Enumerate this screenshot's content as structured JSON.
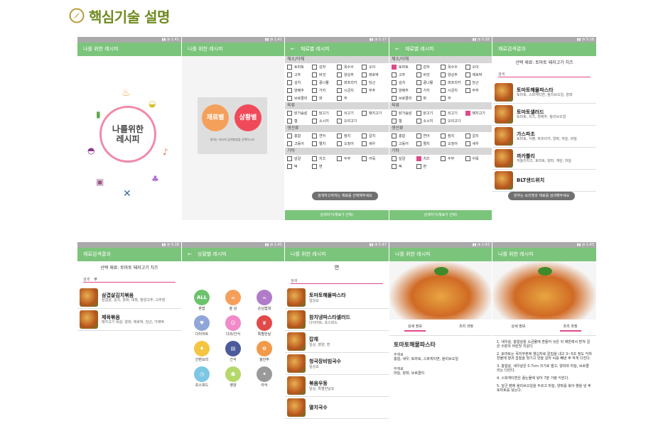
{
  "heading": {
    "title": "핵심기술 설명",
    "accent": "#6f8a1e"
  },
  "theme": {
    "green": "#7bc47b",
    "pink": "#e0488a",
    "status_grey": "#a9a9a9"
  },
  "shots": {
    "s1": {
      "app_title": "나를 위한 레시피",
      "logo_line1": "나를위한",
      "logo_line2": "레시피"
    },
    "s2": {
      "app_title": "나를 위한 레시피",
      "btn_ingredient": "재료별",
      "btn_situation": "상황별",
      "hint": "원하는 레시피 검색방법을 선택하시오"
    },
    "s3": {
      "app_title": "재료별 레시피",
      "toast": "검색하고자하는 재료를 선택해주세요",
      "search_btn": "검색하기(재료가 선택)"
    },
    "s4": {
      "app_title": "재료별 레시피",
      "search_btn": "검색하기(재료가 선택)"
    },
    "categories": [
      {
        "name": "채소/야채",
        "rows": [
          [
            "토마토",
            "감자",
            "옥수수",
            "오이"
          ],
          [
            "고추",
            "버섯",
            "양상추",
            "애호박"
          ],
          [
            "김치",
            "콩나물",
            "파프리카",
            "당근"
          ],
          [
            "양배추",
            "가지",
            "시금치",
            "부추"
          ],
          [
            "브로콜리",
            "파",
            "무",
            ""
          ]
        ]
      },
      {
        "name": "육류",
        "rows": [
          [
            "닭가슴살",
            "닭고기",
            "쇠고기",
            "돼지고기"
          ],
          [
            "햄",
            "소시지",
            "오리고기",
            ""
          ]
        ]
      },
      {
        "name": "생선류",
        "rows": [
          [
            "홍합",
            "연어",
            "참치",
            "갈치"
          ],
          [
            "고등어",
            "멸치",
            "오징어",
            "새우"
          ]
        ]
      },
      {
        "name": "기타",
        "rows": [
          [
            "달걀",
            "치즈",
            "두부",
            "어묵"
          ],
          [
            "떡",
            "면",
            "",
            ""
          ]
        ]
      }
    ],
    "s5": {
      "app_title": "재료검색결과",
      "selected": "선택 재료: 토마토 돼지고기 치즈",
      "search_label": "검색",
      "toast": "원하는 요리명과 재료를 검색해주세요",
      "items": [
        {
          "title": "토마토해물파스타",
          "sub": "토마토, 스파게티면, 올리브오일, 양파"
        },
        {
          "title": "토마토샐러드",
          "sub": "토마토, 치즈, 양배추, 올리브오일"
        },
        {
          "title": "가스파초",
          "sub": "토마토, 식빵, 파프리카, 양파, 마늘, 바질"
        },
        {
          "title": "까카뿔리",
          "sub": "까뇰리치즈, 토마토, 양파, 계란, 마늘"
        },
        {
          "title": "BLT샌드위치",
          "sub": ""
        }
      ]
    },
    "s6": {
      "app_title": "재료검색결과",
      "selected": "선택 재료: 토마토 돼지고기 치즈",
      "search_label": "검색",
      "search_value": "부",
      "items": [
        {
          "title": "삼겹살김치볶음",
          "sub": "삼겹살, 김치, 양파, 대파, 청양고추, 고추장"
        },
        {
          "title": "제육볶음",
          "sub": "돼지고기 목살, 양파, 애호박, 당근, 가래떡"
        }
      ]
    },
    "s7": {
      "app_title": "상황별 레시피",
      "items": [
        {
          "label": "혼밥",
          "icon": "ALL",
          "color": "#6cc36c"
        },
        {
          "label": "술 상",
          "icon": "☕",
          "color": "#f5a05a"
        },
        {
          "label": "손님접대",
          "icon": "☕",
          "color": "#b07cc9"
        },
        {
          "label": "다이어트",
          "icon": "♥",
          "color": "#8fa6d8"
        },
        {
          "label": "다과/간식",
          "icon": "☺",
          "color": "#f08ac8"
        },
        {
          "label": "특별한날",
          "icon": "♛",
          "color": "#e04a4a"
        },
        {
          "label": "간편요리",
          "icon": "♦",
          "color": "#f5c542"
        },
        {
          "label": "간식",
          "icon": "▤",
          "color": "#4a5a9a"
        },
        {
          "label": "술안주",
          "icon": "✿",
          "color": "#f09a4a"
        },
        {
          "label": "초스피드",
          "icon": "◷",
          "color": "#7dc6e4"
        },
        {
          "label": "영양",
          "icon": "☗",
          "color": "#b5d86a"
        },
        {
          "label": "야식",
          "icon": "✦",
          "color": "#9a9a9a"
        }
      ]
    },
    "s8": {
      "app_title": "나를 위한 레시피",
      "category": "면",
      "search_label": "검색",
      "items": [
        {
          "title": "토마토해물파스타",
          "sub": "일상요"
        },
        {
          "title": "참치냉파스타샐러드",
          "sub": "다이어트, 초스피드"
        },
        {
          "title": "잡채",
          "sub": "일상, 영양, 면"
        },
        {
          "title": "청국장비빔국수",
          "sub": "일상요"
        },
        {
          "title": "볶음우동",
          "sub": "일상, 특별한날요"
        },
        {
          "title": "멸치국수",
          "sub": ""
        }
      ]
    },
    "s9": {
      "app_title": "나를 위한 레시피",
      "tab1": "상세 정보",
      "tab2": "조리 과정",
      "dish": "토마토해물파스타",
      "label_ingredients": "주재료",
      "ingredients": "홍합, 새우, 토마토, 스파게티면, 올리브오일",
      "label_sub": "부재료",
      "sub": "마늘, 양파, 브로콜리"
    },
    "s10": {
      "app_title": "나를 위한 레시피",
      "tab1": "상세 정보",
      "tab2": "조리 과정",
      "steps": [
        "1. 새우살, 홍합살을 소금물에 흔들어 씻은 뒤 채반에서 받쳐 걸은 수분과 비린맛 치운다",
        "2. 토마토는 꼭지부분에 열십자로 칼집을 내고 3~5초 정도 익혀 찬물에 헹궈 껍질을 벗기고 반을 갈라 씨를 빼낸 후 작게 다진다.",
        "3. 홍합살, 새우살은 0.7cm 크기로 썰고, 양파와 마늘, 브로콜리는 다진다.",
        "4. 스파게티면은 끓는물에 넣어 7분 가량 익힌다.",
        "5. 달군 팬에 올리브오일을 두르고 마늘, 양파를 볶아 향을 낸 후 토마토를 넣는다."
      ]
    }
  }
}
